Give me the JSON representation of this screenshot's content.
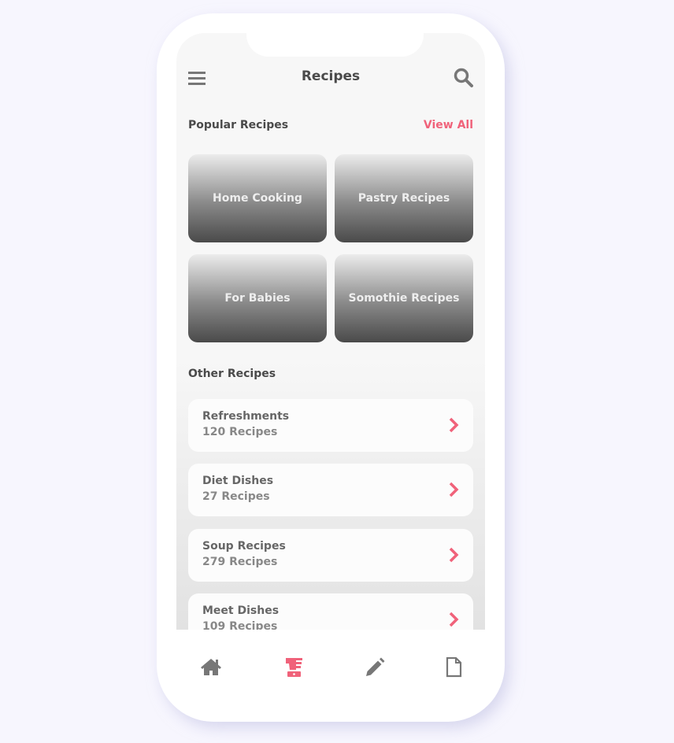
{
  "header": {
    "title": "Recipes"
  },
  "popular": {
    "title": "Popular Recipes",
    "view_all": "View All",
    "cards": [
      "Home Cooking",
      "Pastry Recipes",
      "For Babies",
      "Somothie Recipes"
    ]
  },
  "other": {
    "title": "Other Recipes",
    "items": [
      {
        "name": "Refreshments",
        "count": "120 Recipes"
      },
      {
        "name": "Diet Dishes",
        "count": "27 Recipes"
      },
      {
        "name": "Soup Recipes",
        "count": "279 Recipes"
      },
      {
        "name": "Meet Dishes",
        "count": "109 Recipes"
      }
    ]
  },
  "nav": {
    "active": "recipes",
    "items": [
      "home-icon",
      "blender-icon",
      "pencil-icon",
      "file-icon"
    ]
  },
  "colors": {
    "accent": "#f0627a",
    "icon": "#777777"
  }
}
